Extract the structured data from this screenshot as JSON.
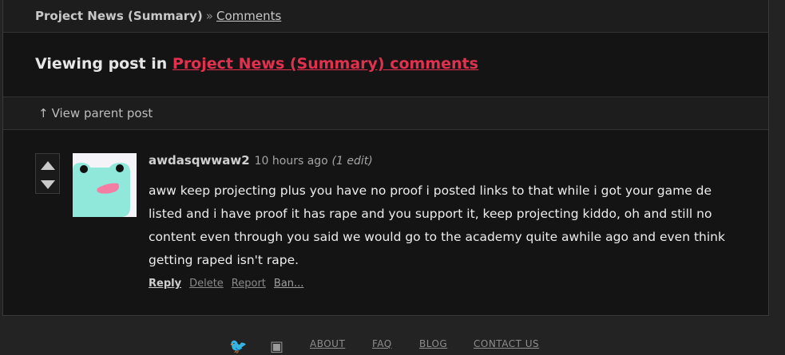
{
  "breadcrumb": {
    "project": "Project News (Summary)",
    "separator": "»",
    "current": "Comments"
  },
  "heading": {
    "prefix": "Viewing post in ",
    "link": "Project News (Summary) comments"
  },
  "parent_bar": {
    "arrow": "↑",
    "label": "View parent post"
  },
  "votes": {
    "up_icon": "triangle-up-icon",
    "down_icon": "triangle-down-icon"
  },
  "comment": {
    "avatar_icon": "frog-avatar",
    "username": "awdasqwwaw2",
    "timestamp": "10 hours ago",
    "edit_note": "(1 edit)",
    "body": "aww keep projecting plus you have no proof i posted links to that while i got your game de listed and i have proof it has rape and you support it, keep projecting kiddo, oh and still no content even through you said we would go to the academy quite awhile ago and even think getting raped isn't rape.",
    "actions": {
      "reply": "Reply",
      "delete": "Delete",
      "report": "Report",
      "ban": "Ban..."
    }
  },
  "footer": {
    "twitter_icon": "twitter-icon",
    "facebook_icon": "facebook-icon",
    "links": [
      "ABOUT",
      "FAQ",
      "BLOG",
      "CONTACT US"
    ]
  },
  "colors": {
    "accent": "#e2314f",
    "avatar_bg": "#f4f3f7",
    "avatar_frog": "#8fe8d9",
    "avatar_tongue": "#f27ea3"
  }
}
